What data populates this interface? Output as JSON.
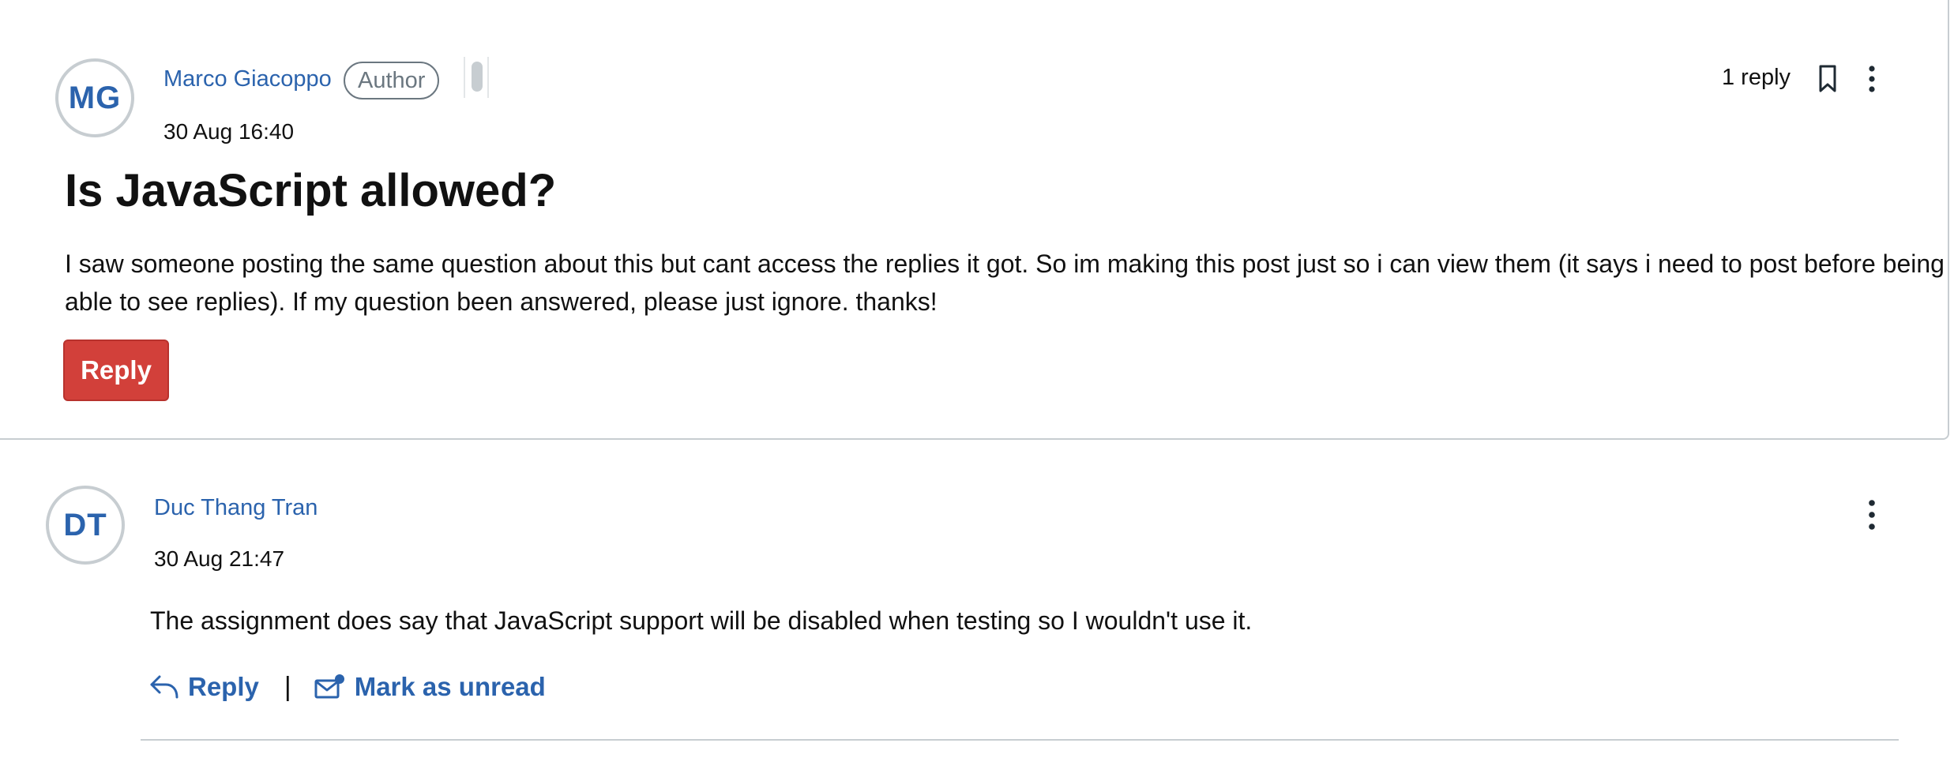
{
  "post": {
    "author": {
      "initials": "MG",
      "name": "Marco Giacoppo",
      "role_badge": "Author"
    },
    "timestamp": "30 Aug 16:40",
    "reply_count": "1 reply",
    "title": "Is JavaScript allowed?",
    "body": "I saw someone posting the same question about this but cant access the replies it got. So im making this post just so i can view them (it says i need to post before being able to see replies). If my question been answered, please just ignore. thanks!",
    "reply_button_label": "Reply",
    "icons": {
      "bookmark": "bookmark-icon",
      "more": "more-options-icon"
    }
  },
  "replies": [
    {
      "author": {
        "initials": "DT",
        "name": "Duc Thang Tran"
      },
      "timestamp": "30 Aug 21:47",
      "body": "The assignment does say that JavaScript support will be disabled when testing so I wouldn't use it.",
      "actions": {
        "reply_label": "Reply",
        "separator": "|",
        "mark_unread_label": "Mark as unread"
      },
      "icons": {
        "reply": "reply-arrow-icon",
        "mark_unread": "envelope-unread-icon",
        "more": "more-options-icon"
      }
    }
  ],
  "colors": {
    "link_blue": "#2b63ad",
    "reply_button_red": "#d2403a",
    "border_gray": "#c7cdd1"
  }
}
